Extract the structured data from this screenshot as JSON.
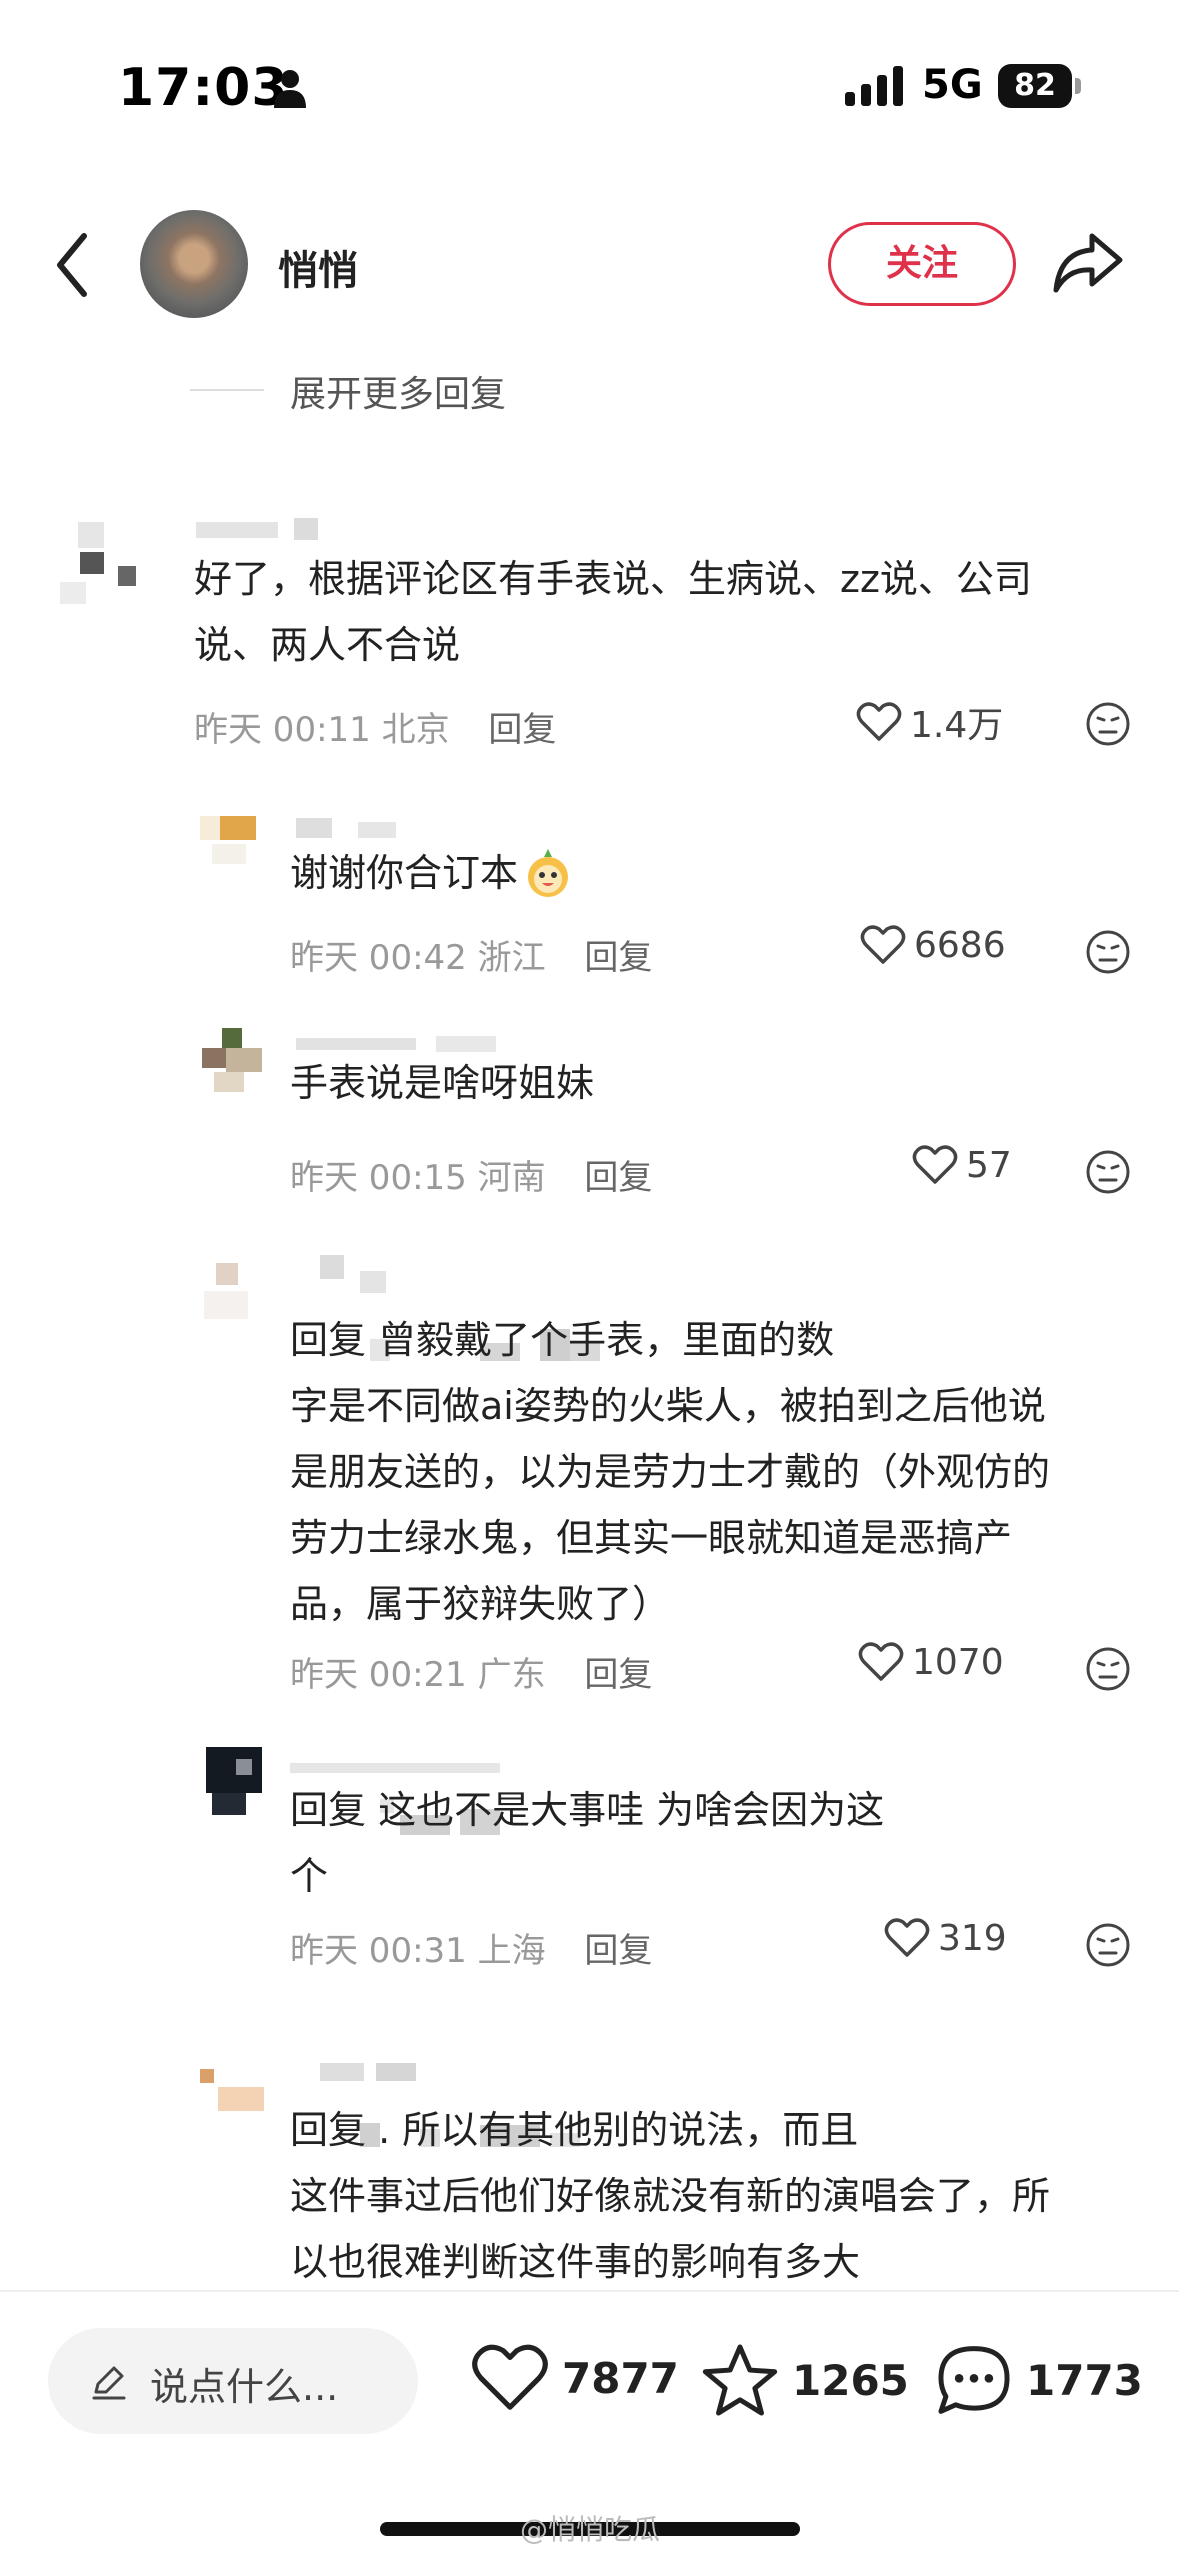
{
  "status_bar": {
    "time": "17:03",
    "network": "5G",
    "battery": "82"
  },
  "header": {
    "username": "悄悄",
    "follow_label": "关注"
  },
  "expand_replies": "展开更多回复",
  "comments": [
    {
      "text_lines": [
        "好了，根据评论区有手表说、生病说、zz说、公司",
        "说、两人不合说"
      ],
      "date": "昨天 00:11",
      "location": "北京",
      "reply_label": "回复",
      "likes": "1.4万"
    },
    {
      "text_lines": [
        "谢谢你合订本"
      ],
      "date": "昨天 00:42",
      "location": "浙江",
      "reply_label": "回复",
      "likes": "6686"
    },
    {
      "text_lines": [
        "手表说是啥呀姐妹"
      ],
      "date": "昨天 00:15",
      "location": "河南",
      "reply_label": "回复",
      "likes": "57"
    },
    {
      "text_lines": [
        "回复                        曾毅戴了个手表，里面的数",
        "字是不同做ai姿势的火柴人，被拍到之后他说",
        "是朋友送的，以为是劳力士才戴的（外观仿的",
        "劳力士绿水鬼，但其实一眼就知道是恶搞产",
        "品，属于狡辩失败了）"
      ],
      "date": "昨天 00:21",
      "location": "广东",
      "reply_label": "回复",
      "likes": "1070"
    },
    {
      "text_lines": [
        "回复              这也不是大事哇 为啥会因为这",
        "个"
      ],
      "date": "昨天 00:31",
      "location": "上海",
      "reply_label": "回复",
      "likes": "319"
    },
    {
      "text_lines": [
        "回复               . 所以有其他别的说法，而且",
        "这件事过后他们好像就没有新的演唱会了，所",
        "以也很难判断这件事的影响有多大"
      ]
    }
  ],
  "bottom_bar": {
    "input_placeholder": "说点什么...",
    "likes": "7877",
    "favorites": "1265",
    "comments": "1773"
  },
  "watermark": "@悄悄吃瓜"
}
